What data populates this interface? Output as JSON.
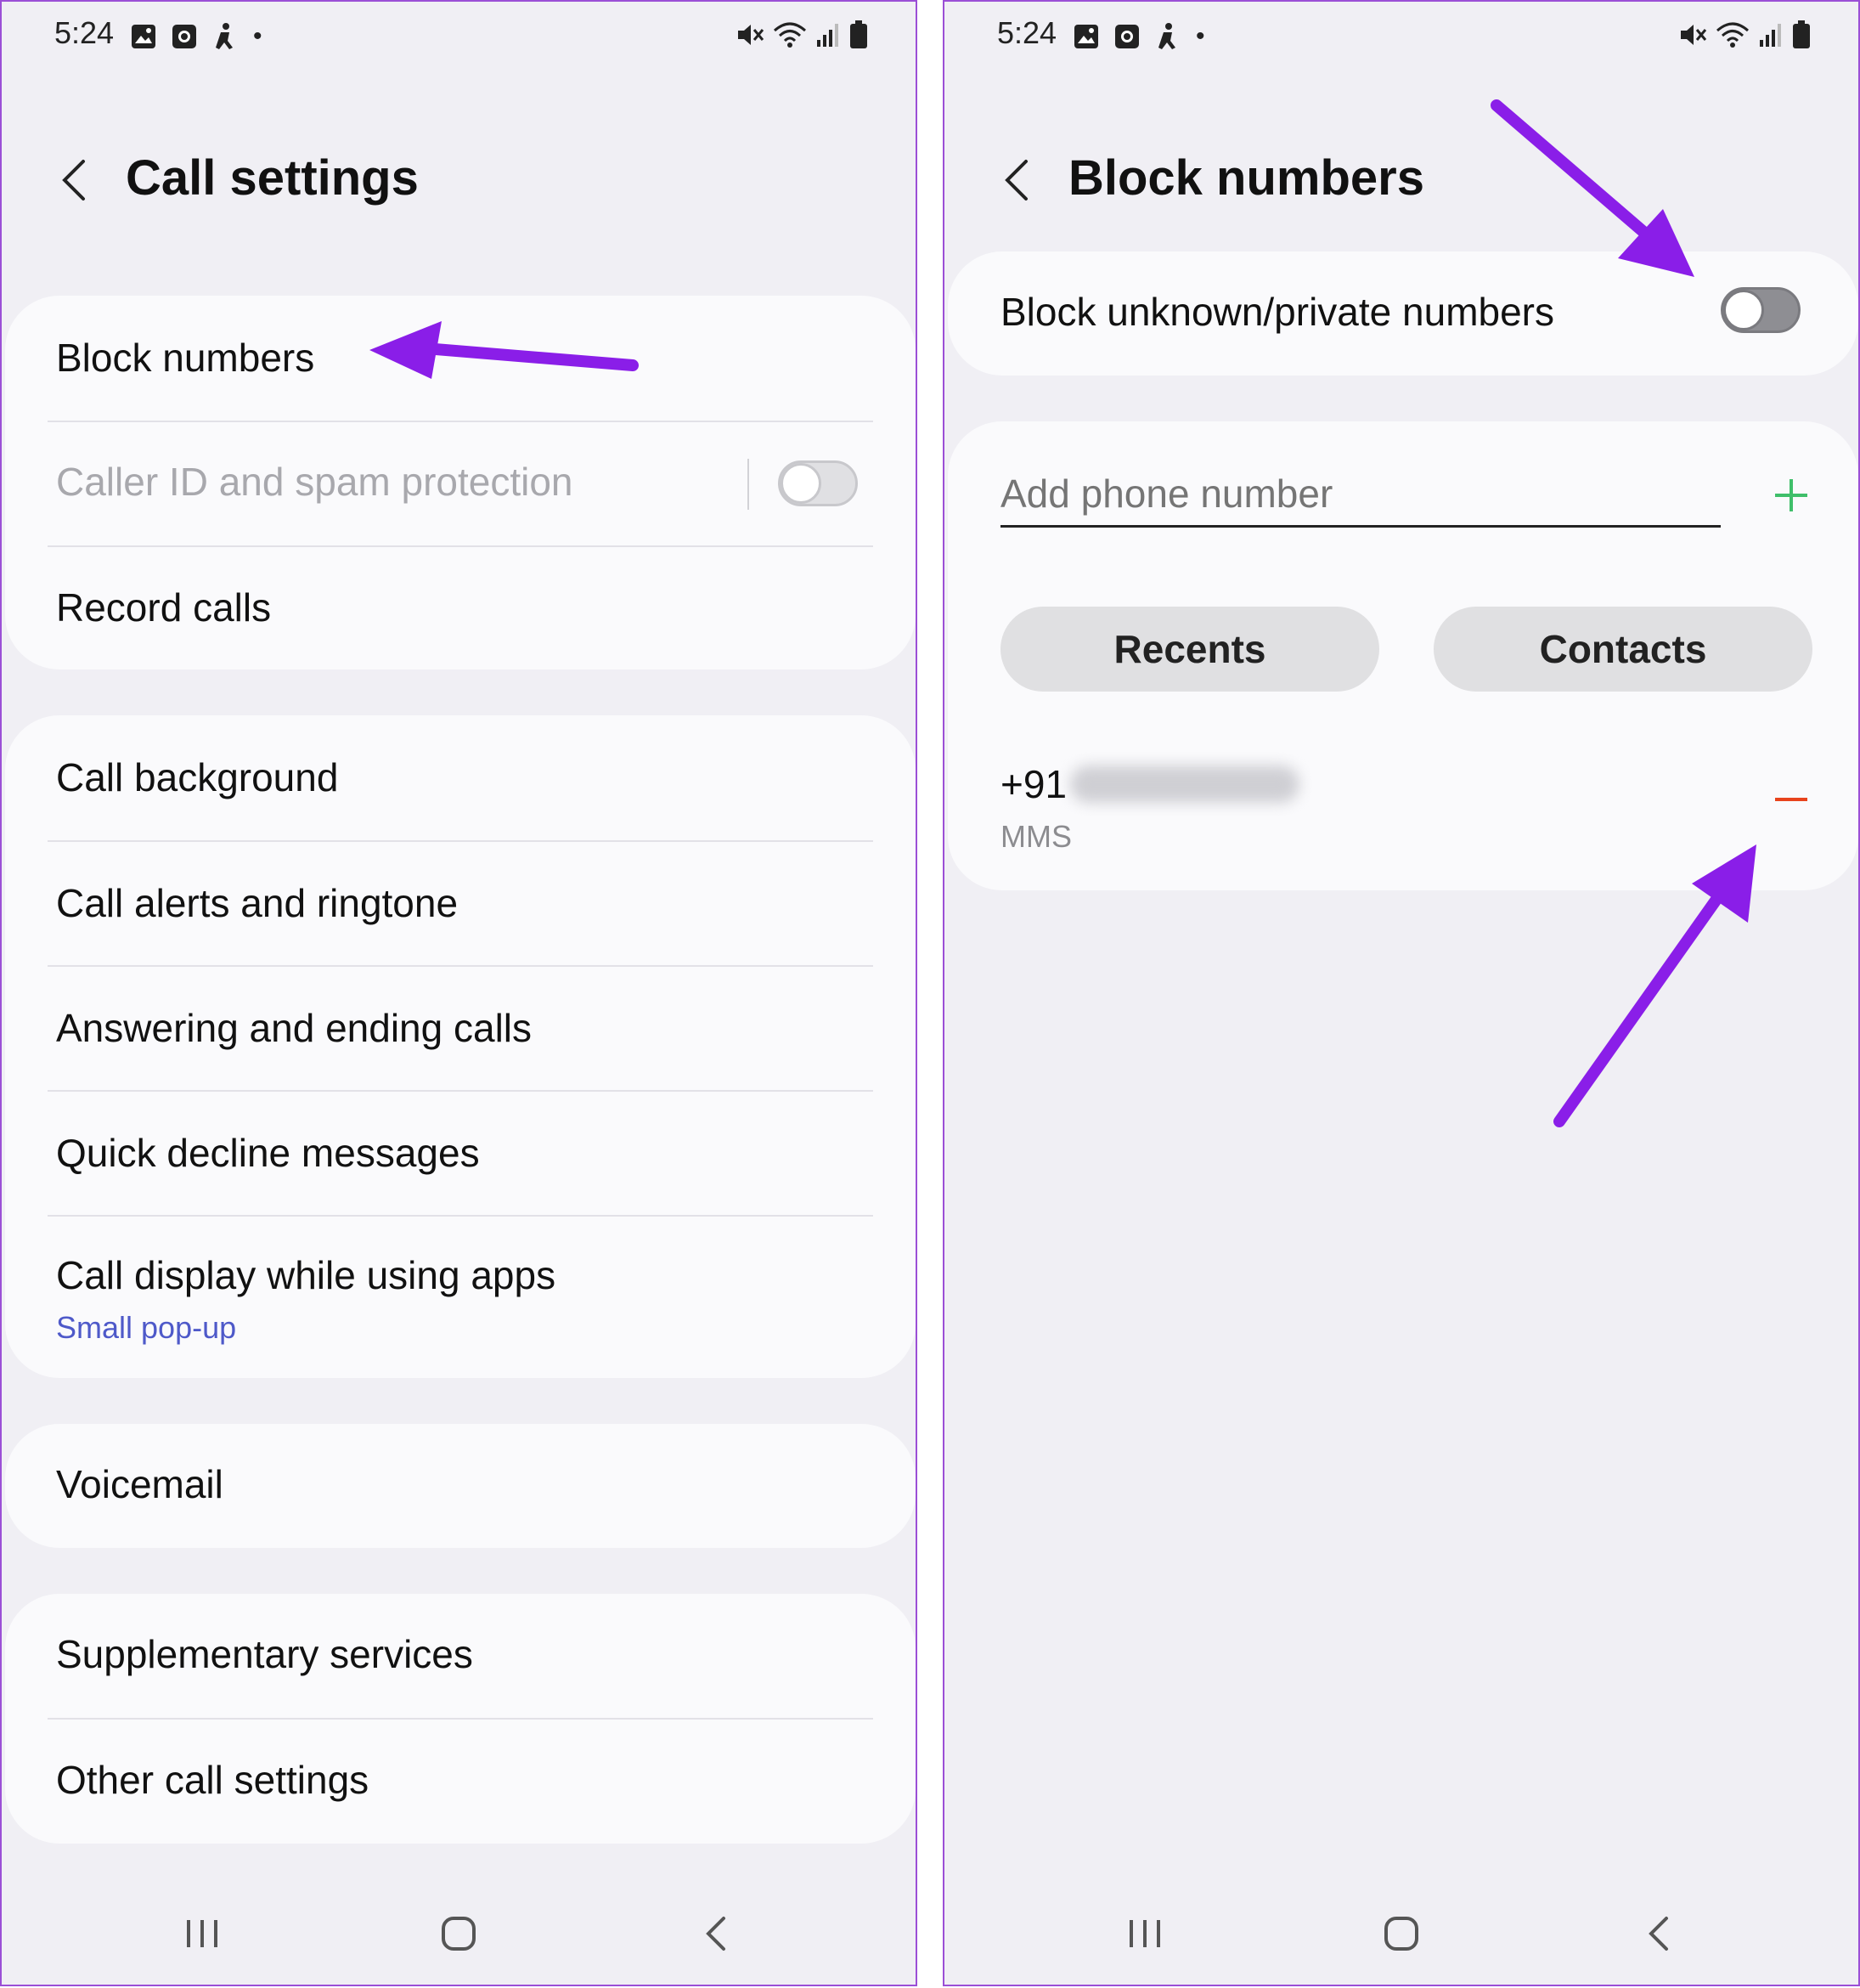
{
  "left_screen": {
    "status": {
      "time": "5:24",
      "dot": "•"
    },
    "title": "Call settings",
    "group1": {
      "block_numbers": "Block numbers",
      "caller_id": "Caller ID and spam protection",
      "caller_id_toggle": "off",
      "record_calls": "Record calls"
    },
    "group2": {
      "call_background": "Call background",
      "call_alerts": "Call alerts and ringtone",
      "answering": "Answering and ending calls",
      "quick_decline": "Quick decline messages",
      "call_display": "Call display while using apps",
      "call_display_sub": "Small pop-up"
    },
    "group3": {
      "voicemail": "Voicemail"
    },
    "group4": {
      "supplementary": "Supplementary services",
      "other": "Other call settings"
    }
  },
  "right_screen": {
    "status": {
      "time": "5:24",
      "dot": "•"
    },
    "title": "Block numbers",
    "block_unknown": {
      "label": "Block unknown/private numbers",
      "toggle": "off"
    },
    "add_number": {
      "placeholder": "Add phone number",
      "add_icon": "plus-icon"
    },
    "buttons": {
      "recents": "Recents",
      "contacts": "Contacts"
    },
    "blocked_list": [
      {
        "number_prefix": "+91",
        "type": "MMS",
        "remove_icon": "minus-icon"
      }
    ]
  },
  "nav_icons": [
    "recent-apps-icon",
    "home-icon",
    "back-icon"
  ],
  "colors": {
    "accent_purple": "#8a1ee8",
    "sub_blue": "#4e59c9",
    "add_green": "#3fbf6a",
    "remove_red": "#e8431c",
    "background": "#f0eff4",
    "card": "#fafafc"
  }
}
